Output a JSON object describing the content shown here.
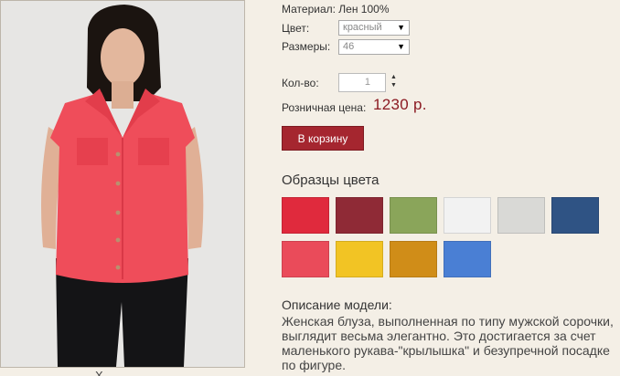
{
  "product": {
    "material_text": "Материал: Лен 100%",
    "color_label": "Цвет:",
    "color_value": "красный",
    "size_label": "Размеры:",
    "size_value": "46",
    "qty_label": "Кол-во:",
    "qty_value": "1",
    "price_label": "Розничная цена:",
    "price_value": "1230 р.",
    "cart_button": "В корзину",
    "caption": "Х"
  },
  "samples": {
    "title": "Образцы цвета",
    "swatches": [
      {
        "name": "swatch-red",
        "color": "#e02a3d"
      },
      {
        "name": "swatch-burgundy",
        "color": "#8f2a36"
      },
      {
        "name": "swatch-green",
        "color": "#8aa55a"
      },
      {
        "name": "swatch-white",
        "color": "#f2f2f2"
      },
      {
        "name": "swatch-light-gray",
        "color": "#d9d9d6"
      },
      {
        "name": "swatch-navy",
        "color": "#2f5384"
      },
      {
        "name": "swatch-coral",
        "color": "#ea4b5a"
      },
      {
        "name": "swatch-yellow",
        "color": "#f2c424"
      },
      {
        "name": "swatch-mustard",
        "color": "#d08d18"
      },
      {
        "name": "swatch-blue",
        "color": "#4a7fd4"
      }
    ]
  },
  "description": {
    "title": "Описание модели:",
    "text": "Женская блуза, выполненная по типу мужской сорочки, выглядит весьма элегантно. Это достигается за счет маленького рукава-\"крылышка\" и безупречной посадке по фигуре."
  }
}
